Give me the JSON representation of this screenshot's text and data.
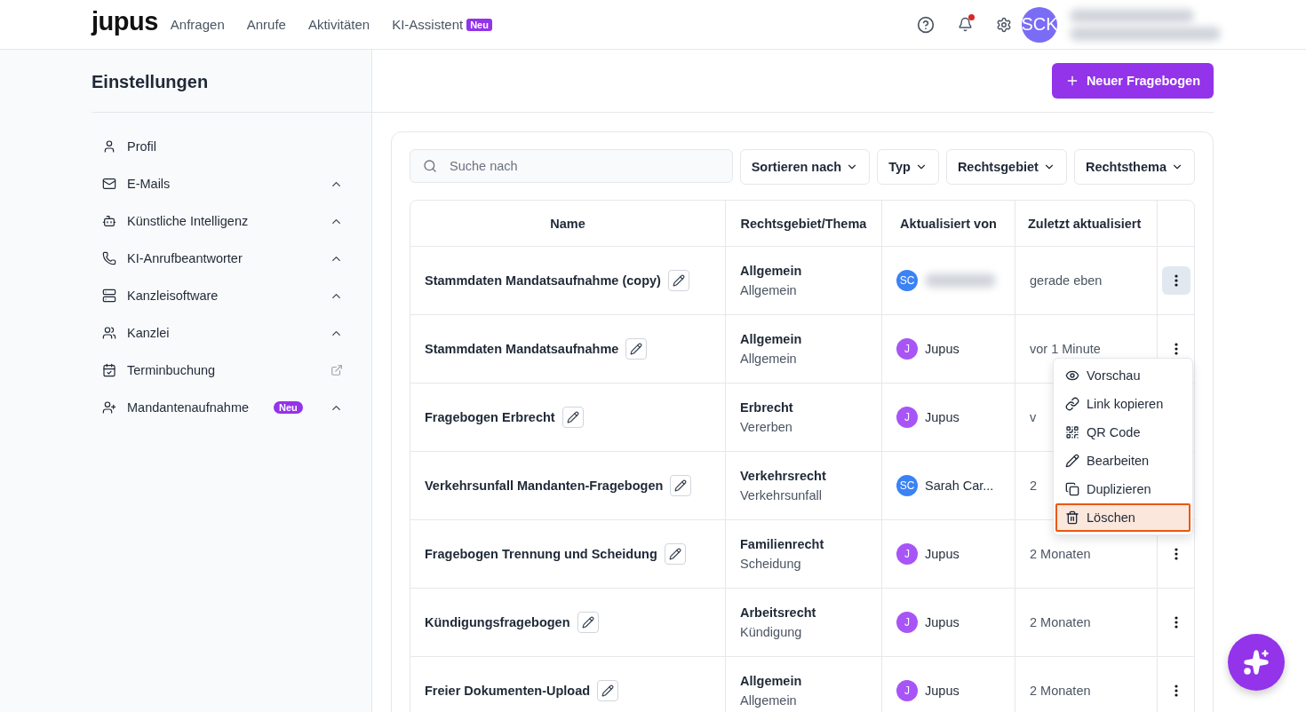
{
  "brand": "jupus",
  "nav": [
    {
      "label": "Anfragen"
    },
    {
      "label": "Anrufe"
    },
    {
      "label": "Aktivitäten"
    },
    {
      "label": "KI-Assistent",
      "badge": "Neu"
    }
  ],
  "header": {
    "notification_dot": true,
    "avatar": {
      "initials": "SCK",
      "color": "#7b6cf6"
    },
    "user_redacted": true
  },
  "sidebar": {
    "title": "Einstellungen",
    "items": [
      {
        "label": "Profil",
        "kind": "page"
      },
      {
        "label": "E-Mails",
        "kind": "group"
      },
      {
        "label": "Künstliche Intelligenz",
        "kind": "group"
      },
      {
        "label": "KI-Anrufbeantworter",
        "kind": "group"
      },
      {
        "label": "Kanzleisoftware",
        "kind": "group"
      },
      {
        "label": "Kanzlei",
        "kind": "group"
      },
      {
        "label": "Terminbuchung",
        "kind": "external"
      },
      {
        "label": "Mandantenaufnahme",
        "kind": "group",
        "badge": "Neu"
      }
    ]
  },
  "new_button": "Neuer Fragebogen",
  "search": {
    "placeholder": "Suche nach"
  },
  "filters": [
    "Sortieren nach",
    "Typ",
    "Rechtsgebiet",
    "Rechtsthema"
  ],
  "table": {
    "columns": [
      "Name",
      "Rechtsgebiet/Thema",
      "Aktualisiert von",
      "Zuletzt aktualisiert"
    ],
    "rows": [
      {
        "name": "Stammdaten Mandatsaufnahme (copy)",
        "area": "Allgemein",
        "topic": "Allgemein",
        "updater": {
          "initials": "SC",
          "redacted": true,
          "color": "#3b82f6"
        },
        "updated": "gerade eben",
        "menu_open": true
      },
      {
        "name": "Stammdaten Mandatsaufnahme",
        "area": "Allgemein",
        "topic": "Allgemein",
        "updater": {
          "initials": "J",
          "name": "Jupus",
          "color": "#a855f7"
        },
        "updated": "vor 1 Minute",
        "menu_open": false
      },
      {
        "name": "Fragebogen Erbrecht",
        "area": "Erbrecht",
        "topic": "Vererben",
        "updater": {
          "initials": "J",
          "name": "Jupus",
          "color": "#a855f7"
        },
        "updated": "v"
      },
      {
        "name": "Verkehrsunfall Mandanten-Fragebogen",
        "area": "Verkehrsrecht",
        "topic": "Verkehrsunfall",
        "updater": {
          "initials": "SC",
          "name": "Sarah Car...",
          "color": "#3b82f6"
        },
        "updated": "2"
      },
      {
        "name": "Fragebogen Trennung und Scheidung",
        "area": "Familienrecht",
        "topic": "Scheidung",
        "updater": {
          "initials": "J",
          "name": "Jupus",
          "color": "#a855f7"
        },
        "updated": "2 Monaten",
        "menu_open": false
      },
      {
        "name": "Kündigungsfragebogen",
        "area": "Arbeitsrecht",
        "topic": "Kündigung",
        "updater": {
          "initials": "J",
          "name": "Jupus",
          "color": "#a855f7"
        },
        "updated": "2 Monaten",
        "menu_open": false
      },
      {
        "name": "Freier Dokumenten-Upload",
        "area": "Allgemein",
        "topic": "Allgemein",
        "updater": {
          "initials": "J",
          "name": "Jupus",
          "color": "#a855f7"
        },
        "updated": "2 Monaten",
        "menu_open": false
      }
    ]
  },
  "context_menu": {
    "items": [
      {
        "label": "Vorschau",
        "selected": false
      },
      {
        "label": "Link kopieren",
        "selected": false
      },
      {
        "label": "QR Code",
        "selected": false
      },
      {
        "label": "Bearbeiten",
        "selected": false
      },
      {
        "label": "Duplizieren",
        "selected": false
      },
      {
        "label": "Löschen",
        "selected": true
      }
    ]
  }
}
